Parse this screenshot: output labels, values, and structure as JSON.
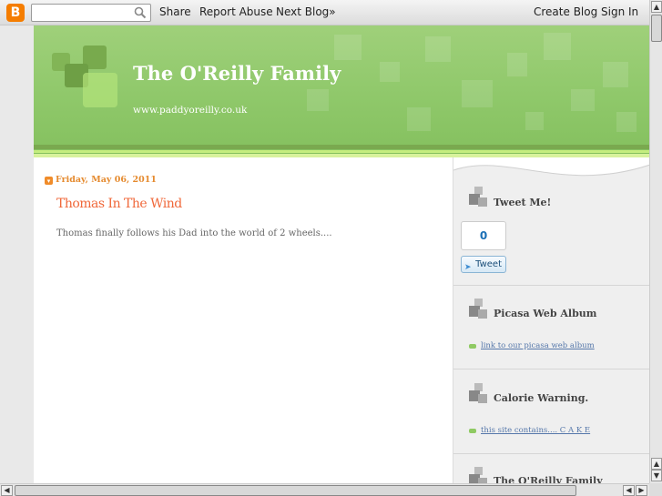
{
  "navbar": {
    "logo": "B",
    "search_placeholder": "",
    "share": "Share",
    "report_abuse": "Report Abuse",
    "next_blog": "Next Blog»",
    "create_blog": "Create Blog",
    "sign_in": "Sign In"
  },
  "header": {
    "title": "The O'Reilly Family",
    "description": "www.paddyoreilly.co.uk"
  },
  "post": {
    "date": "Friday, May 06, 2011",
    "title": "Thomas In The Wind",
    "body": "Thomas finally follows his Dad into the world of 2 wheels...."
  },
  "sidebar": {
    "tweet_widget": {
      "heading": "Tweet Me!",
      "count": "0",
      "button": "Tweet"
    },
    "picasa_widget": {
      "heading": "Picasa Web Album",
      "link": "link to our picasa web album"
    },
    "calorie_widget": {
      "heading": "Calorie Warning.",
      "link": "this site contains.... C A K E"
    },
    "family_widget": {
      "heading": "The O'Reilly Family"
    }
  },
  "colors": {
    "header_green": "#8fc86a",
    "post_title": "#f0683a",
    "date_orange": "#e58a2e"
  }
}
